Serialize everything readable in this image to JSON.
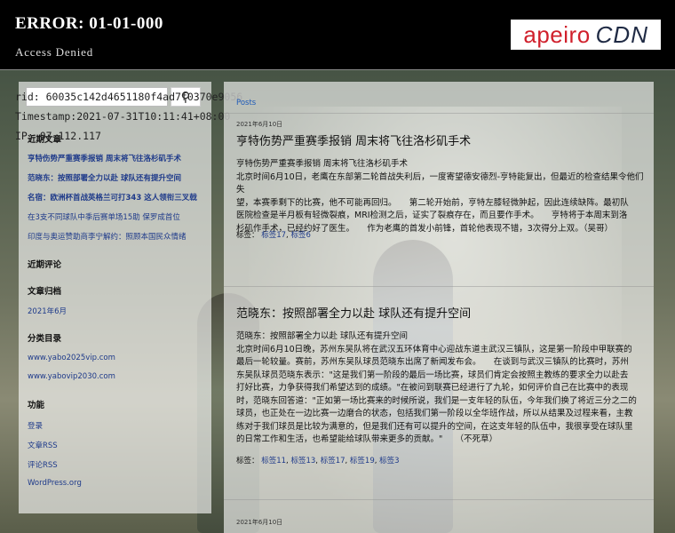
{
  "error": {
    "title": "ERROR: 01-01-000",
    "subtitle": "Access Denied",
    "rid": "rid: 60035c142d4651180f4ad7f0370e9056",
    "timestamp": "Timestamp:2021-07-31T10:11:41+08:00",
    "ip": "IP: 07.112.117"
  },
  "logo": {
    "left": "apeiro",
    "right": "CDN",
    "left_color": "#d0202c",
    "right_color": "#1f2a44"
  },
  "sidebar": {
    "search_icon": "search-icon",
    "recent_posts_heading": "近期文章",
    "recent_posts": [
      "亨特伤势严重赛季报销 周末将飞往洛杉矶手术",
      "范晓东：按照部署全力以赴 球队还有提升空间",
      "名宿：欧洲杯首战英格兰可打343 这人领衔三叉戟",
      "在3支不同球队中季后赛单场15助 保罗成首位",
      "印度与奥运赞助商李宁解约：照顾本国民众情绪"
    ],
    "recent_comments_heading": "近期评论",
    "archives_heading": "文章归档",
    "archives": [
      "2021年6月"
    ],
    "categories_heading": "分类目录",
    "categories": [
      "www.yabo2025vip.com",
      "www.yabovip2030.com"
    ],
    "meta_heading": "功能",
    "meta": [
      "登录",
      "文章RSS",
      "评论RSS",
      "WordPress.org"
    ]
  },
  "main": {
    "posts_label": "Posts",
    "post1": {
      "date": "2021年6月10日",
      "title": "亨特伤势严重赛季报销 周末将飞往洛杉矶手术",
      "lines": [
        "亨特伤势严重赛季报销 周末将飞往洛杉矶手术",
        "北京时间6月10日，老鹰在东部第二轮首战失利后，一度寄望德安德烈-亨特能复出，但最近的检查结果令他们失",
        "望，本赛季剩下的比赛，他不可能再回归。　　第二轮开始前，亨特左膝轻微肿起，因此连续缺阵。最初队",
        "医院检查是半月板有轻微裂痕，MRI检测之后，证实了裂痕存在，而且要作手术。　　亨特将于本周末到洛",
        "杉矶作手术，已经约好了医生。　　作为老鹰的首发小前锋，首轮他表现不错，3次得分上双。（吴哥）"
      ],
      "tags_label": "标签：",
      "tags": [
        "标签17",
        "标签6"
      ]
    },
    "post2": {
      "title": "范晓东：按照部署全力以赴 球队还有提升空间",
      "lines": [
        "范晓东：按照部署全力以赴 球队还有提升空间",
        "北京时间6月10日晚，苏州东吴队将在武汉五环体育中心迎战东道主武汉三镇队，这是第一阶段中甲联赛的",
        "最后一轮较量。赛前，苏州东吴队球员范晓东出席了新闻发布会。　　在谈到与武汉三镇队的比赛时，苏州",
        "东吴队球员范晓东表示：\"这是我们第一阶段的最后一场比赛，球员们肯定会按照主教练的要求全力以赴去",
        "打好比赛，力争获得我们希望达到的成绩。\"在被问到联赛已经进行了九轮，如何评价自己在比赛中的表现",
        "时，范晓东回答道：\"正如第一场比赛来的时候所说，我们是一支年轻的队伍，今年我们换了将近三分之二的",
        "球员，也正处在一边比赛一边磨合的状态，包括我们第一阶段以全华班作战，所以从结果及过程来看，主教",
        "练对于我们球员是比较为满意的，但是我们还有可以提升的空间，在这支年轻的队伍中，我很享受在球队里",
        "的日常工作和生活，也希望能给球队带来更多的贡献。\"　　（不死草）"
      ],
      "tags_label": "标签：",
      "tags": [
        "标签11",
        "标签13",
        "标签17",
        "标签19",
        "标签3"
      ]
    },
    "post3_date": "2021年6月10日"
  }
}
